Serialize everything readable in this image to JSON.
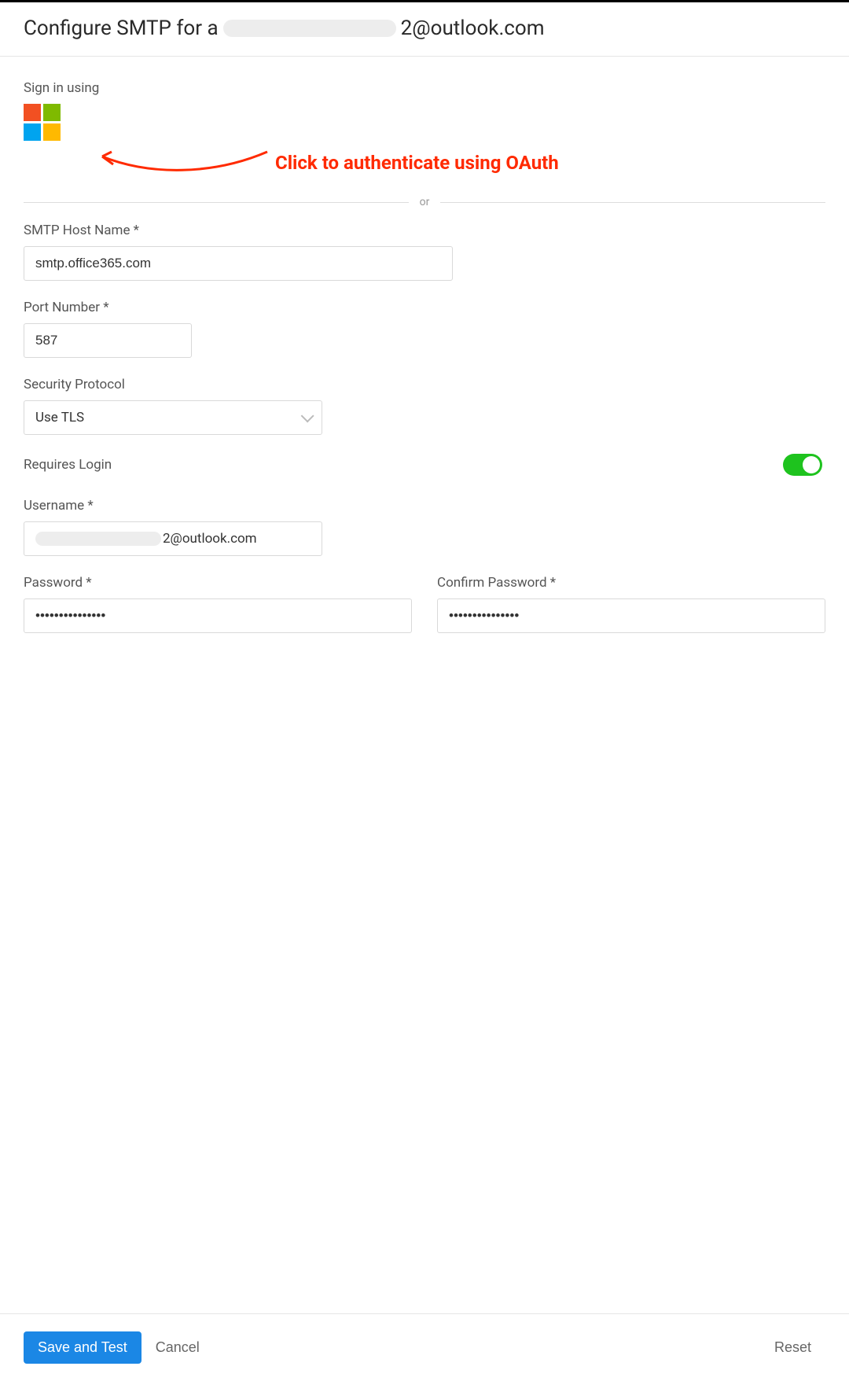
{
  "header": {
    "title_prefix": "Configure SMTP for a",
    "title_suffix": "2@outlook.com"
  },
  "signin": {
    "label": "Sign in using",
    "oauth_hint": "Click to authenticate using OAuth"
  },
  "divider": {
    "or": "or"
  },
  "fields": {
    "host_label": "SMTP Host Name *",
    "host_value": "smtp.office365.com",
    "port_label": "Port Number *",
    "port_value": "587",
    "protocol_label": "Security Protocol",
    "protocol_value": "Use TLS",
    "requires_login_label": "Requires Login",
    "requires_login_on": true,
    "username_label": "Username *",
    "username_suffix": "2@outlook.com",
    "password_label": "Password *",
    "password_value": "•••••••••••••••",
    "confirm_label": "Confirm Password *",
    "confirm_value": "•••••••••••••••"
  },
  "footer": {
    "save": "Save and Test",
    "cancel": "Cancel",
    "reset": "Reset"
  }
}
